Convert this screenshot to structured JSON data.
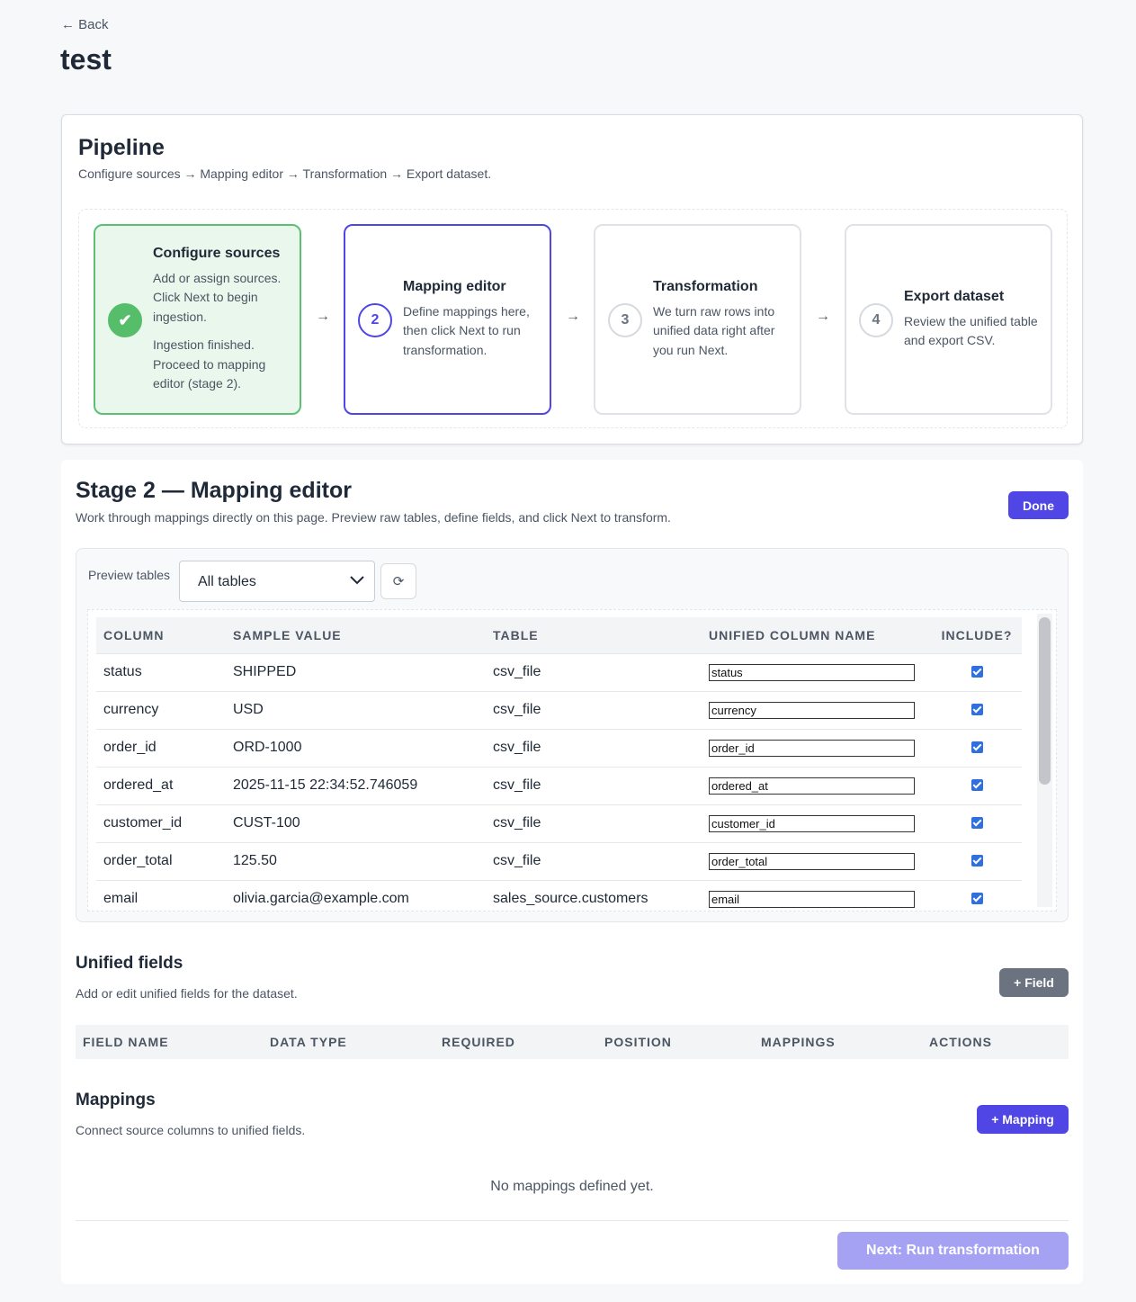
{
  "nav": {
    "back_label": "← Back"
  },
  "page": {
    "title": "test"
  },
  "pipeline": {
    "title": "Pipeline",
    "subtitle": "Configure sources → Mapping editor → Transformation → Export dataset.",
    "arrow": "→",
    "stages": [
      {
        "marker": "✔",
        "title": "Configure sources",
        "desc": "Add or assign sources. Click Next to begin ingestion.",
        "note": "Ingestion finished. Proceed to mapping editor (stage 2).",
        "status": "done"
      },
      {
        "marker": "2",
        "title": "Mapping editor",
        "desc": "Define mappings here, then click Next to run transformation.",
        "status": "active"
      },
      {
        "marker": "3",
        "title": "Transformation",
        "desc": "We turn raw rows into unified data right after you run Next.",
        "status": "pending"
      },
      {
        "marker": "4",
        "title": "Export dataset",
        "desc": "Review the unified table and export CSV.",
        "status": "pending"
      }
    ]
  },
  "stage2": {
    "title": "Stage 2 — Mapping editor",
    "subtitle": "Work through mappings directly on this page. Preview raw tables, define fields, and click Next to transform.",
    "done_label": "Done",
    "preview": {
      "label": "Preview tables",
      "selected": "All tables",
      "refresh_icon": "⟳",
      "columns": [
        "COLUMN",
        "SAMPLE VALUE",
        "TABLE",
        "UNIFIED COLUMN NAME",
        "INCLUDE?"
      ],
      "rows": [
        {
          "column": "status",
          "sample": "SHIPPED",
          "table": "csv_file",
          "unified": "status",
          "include": true
        },
        {
          "column": "currency",
          "sample": "USD",
          "table": "csv_file",
          "unified": "currency",
          "include": true
        },
        {
          "column": "order_id",
          "sample": "ORD-1000",
          "table": "csv_file",
          "unified": "order_id",
          "include": true
        },
        {
          "column": "ordered_at",
          "sample": "2025-11-15 22:34:52.746059",
          "table": "csv_file",
          "unified": "ordered_at",
          "include": true
        },
        {
          "column": "customer_id",
          "sample": "CUST-100",
          "table": "csv_file",
          "unified": "customer_id",
          "include": true
        },
        {
          "column": "order_total",
          "sample": "125.50",
          "table": "csv_file",
          "unified": "order_total",
          "include": true
        },
        {
          "column": "email",
          "sample": "olivia.garcia@example.com",
          "table": "sales_source.customers",
          "unified": "email",
          "include": true
        }
      ]
    },
    "unified_fields": {
      "title": "Unified fields",
      "subtitle": "Add or edit unified fields for the dataset.",
      "add_label": "+ Field",
      "columns": [
        "FIELD NAME",
        "DATA TYPE",
        "REQUIRED",
        "POSITION",
        "MAPPINGS",
        "ACTIONS"
      ]
    },
    "mappings": {
      "title": "Mappings",
      "subtitle": "Connect source columns to unified fields.",
      "add_label": "+ Mapping",
      "empty": "No mappings defined yet."
    },
    "next_label": "Next: Run transformation"
  },
  "colors": {
    "accent": "#4f46e5",
    "success": "#56be6a",
    "disabled": "#a5a1f3",
    "neutral_button": "#6b7280"
  }
}
